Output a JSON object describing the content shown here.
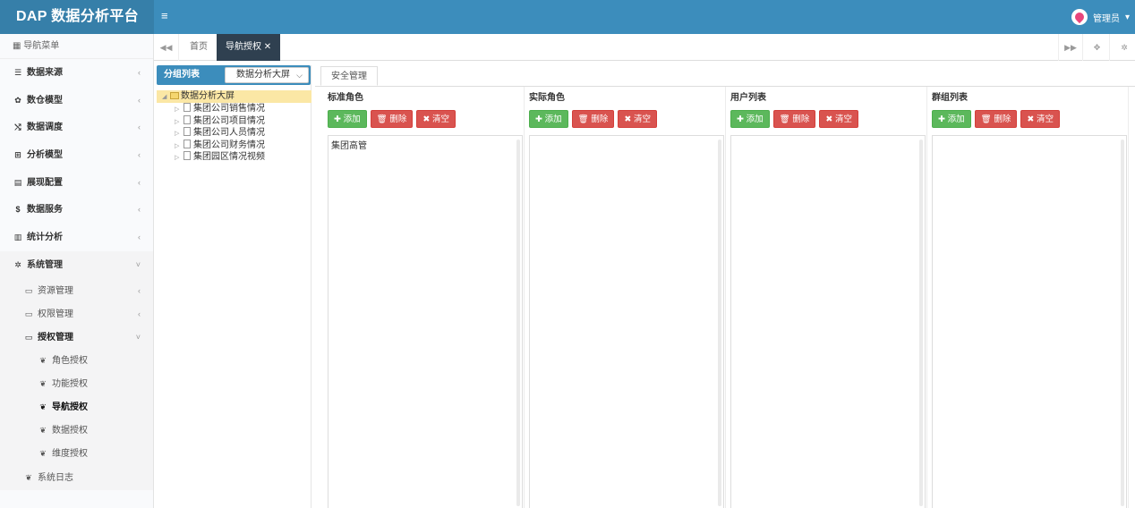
{
  "app": {
    "title": "DAP 数据分析平台",
    "user": "管理员"
  },
  "sidebar": {
    "header": "导航菜单",
    "items": [
      {
        "label": "数据来源",
        "icon": "database-icon"
      },
      {
        "label": "数仓模型",
        "icon": "cubes-icon"
      },
      {
        "label": "数据调度",
        "icon": "random-icon"
      },
      {
        "label": "分析模型",
        "icon": "sitemap-icon"
      },
      {
        "label": "展现配置",
        "icon": "film-icon"
      },
      {
        "label": "数据服务",
        "icon": "dollar-icon"
      },
      {
        "label": "统计分析",
        "icon": "bar-chart-icon"
      },
      {
        "label": "系统管理",
        "icon": "gear-icon"
      }
    ],
    "sub": [
      {
        "label": "资源管理"
      },
      {
        "label": "权限管理"
      },
      {
        "label": "授权管理"
      }
    ],
    "sub3": [
      {
        "label": "角色授权"
      },
      {
        "label": "功能授权"
      },
      {
        "label": "导航授权"
      },
      {
        "label": "数据授权"
      },
      {
        "label": "维度授权"
      }
    ],
    "log": "系统日志"
  },
  "tabs": {
    "home": "首页",
    "current": "导航授权"
  },
  "group": {
    "title": "分组列表",
    "selected": "数据分析大屏",
    "root": "数据分析大屏",
    "nodes": [
      "集团公司销售情况",
      "集团公司项目情况",
      "集团公司人员情况",
      "集团公司财务情况",
      "集团园区情况视频"
    ]
  },
  "security_tab": "安全管理",
  "columns": [
    {
      "title": "标准角色",
      "items": [
        "集团高管"
      ]
    },
    {
      "title": "实际角色",
      "items": []
    },
    {
      "title": "用户列表",
      "items": []
    },
    {
      "title": "群组列表",
      "items": []
    }
  ],
  "buttons": {
    "add": "添加",
    "delete": "删除",
    "clear": "清空"
  },
  "colors": {
    "header": "#3c8dbc",
    "logo": "#367fa9",
    "add": "#5cb85c",
    "delete": "#d9534f",
    "active_tab": "#2f4050"
  }
}
